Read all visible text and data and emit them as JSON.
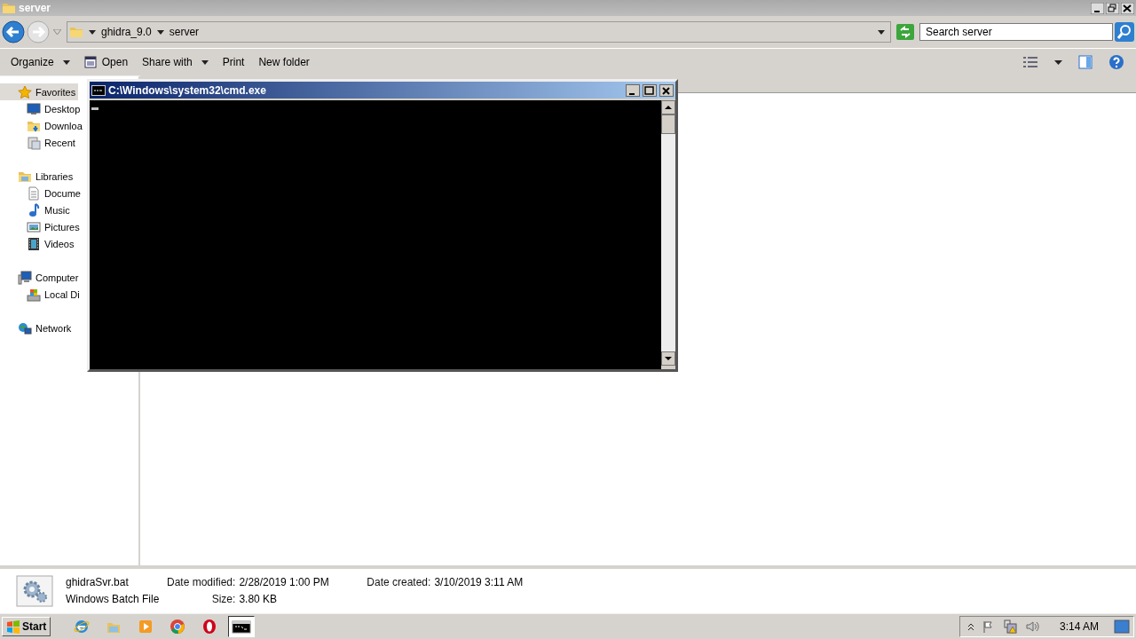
{
  "window": {
    "title": "server"
  },
  "address": {
    "crumbs": [
      "ghidra_9.0",
      "server"
    ]
  },
  "search": {
    "placeholder": "Search server"
  },
  "toolbar": [
    {
      "label": "Organize",
      "kind": "menu"
    },
    {
      "label": "Open",
      "kind": "open"
    },
    {
      "label": "Share with",
      "kind": "menu"
    },
    {
      "label": "Print",
      "kind": "plain"
    },
    {
      "label": "New folder",
      "kind": "plain"
    }
  ],
  "sidebar": {
    "groups": [
      {
        "label": "Favorites",
        "kind": "star",
        "selected": true,
        "children": [
          {
            "label": "Desktop",
            "kind": "desktop"
          },
          {
            "label": "Downloa",
            "kind": "downloads"
          },
          {
            "label": "Recent",
            "kind": "recent"
          }
        ]
      },
      {
        "label": "Libraries",
        "kind": "libraries",
        "selected": false,
        "children": [
          {
            "label": "Docume",
            "kind": "document"
          },
          {
            "label": "Music",
            "kind": "music"
          },
          {
            "label": "Pictures",
            "kind": "pictures"
          },
          {
            "label": "Videos",
            "kind": "videos"
          }
        ]
      },
      {
        "label": "Computer",
        "kind": "computer",
        "selected": false,
        "children": [
          {
            "label": "Local Di",
            "kind": "disk"
          }
        ]
      },
      {
        "label": "Network",
        "kind": "network",
        "selected": false
      }
    ]
  },
  "console_window": {
    "title": "C:\\Windows\\system32\\cmd.exe"
  },
  "details": {
    "name": "ghidraSvr.bat",
    "type": "Windows Batch File",
    "fields": [
      {
        "label": "Date modified:",
        "value": "2/28/2019 1:00 PM"
      },
      {
        "label": "Date created:",
        "value": "3/10/2019 3:11 AM"
      },
      {
        "label": "Size:",
        "value": "3.80 KB"
      }
    ]
  },
  "taskbar": {
    "start": "Start",
    "apps": [
      {
        "kind": "ie",
        "selected": false
      },
      {
        "kind": "explorer",
        "selected": false
      },
      {
        "kind": "media",
        "selected": false
      },
      {
        "kind": "chrome",
        "selected": false
      },
      {
        "kind": "opera",
        "selected": false
      },
      {
        "kind": "cmd",
        "selected": true
      }
    ],
    "clock": "3:14 AM"
  }
}
